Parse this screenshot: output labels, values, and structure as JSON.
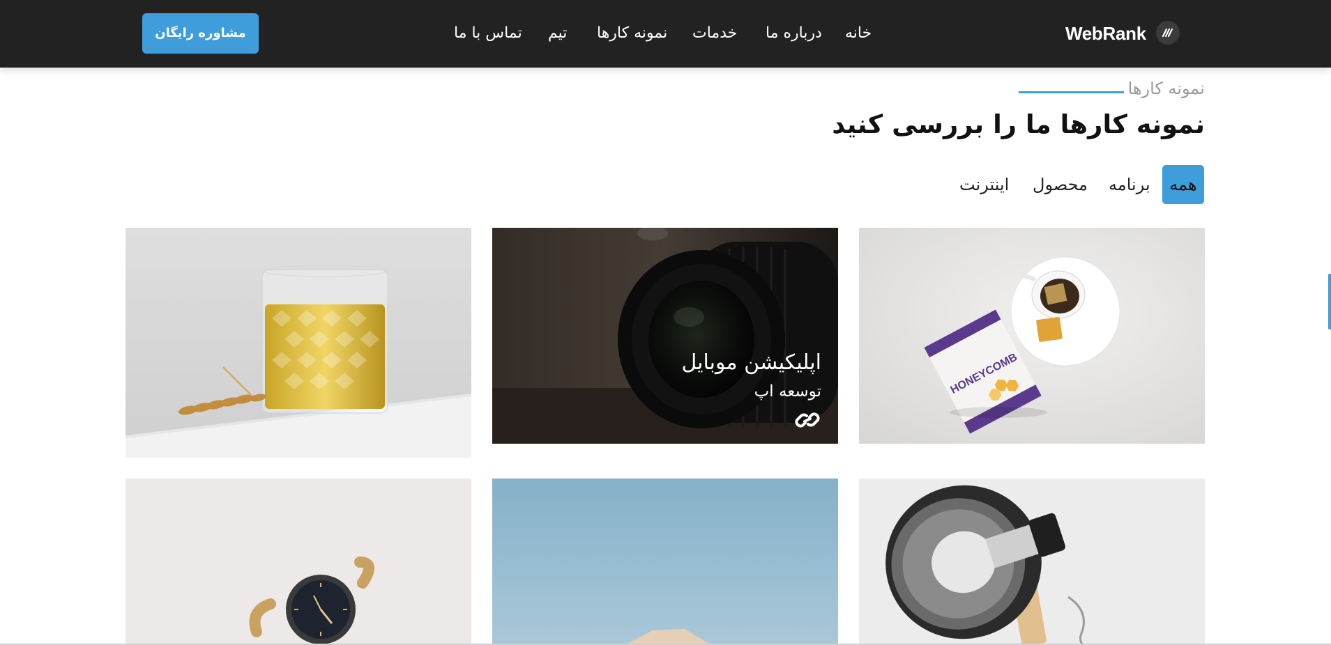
{
  "header": {
    "brand": "WebRank",
    "brand_logo_icon": "webrank-logo-icon",
    "cta_label": "مشاوره رایگان",
    "nav": [
      "خانه",
      "درباره ما",
      "خدمات",
      "نمونه کارها",
      "تیم",
      "تماس با ما"
    ]
  },
  "portfolio": {
    "eyebrow": "نمونه کارها",
    "title": "نمونه کارها ما را بررسی کنید",
    "filters": [
      "همه",
      "برنامه",
      "محصول",
      "اینترنت"
    ],
    "active_filter": "همه",
    "items": [
      {
        "image": "honeycomb-tea-product-photo"
      },
      {
        "image": "camera-lens-photo",
        "title": "اپلیکیشن موبایل",
        "subtitle": "توسعه اپ",
        "link_icon": "link-icon"
      },
      {
        "image": "glass-of-oil-with-wheat-photo"
      },
      {
        "image": "desk-lamp-photo"
      },
      {
        "image": "blue-sky-product-photo"
      },
      {
        "image": "wrist-watch-photo"
      }
    ]
  },
  "colors": {
    "header_bg": "#222222",
    "accent": "#3f9ddb",
    "text": "#111111",
    "muted": "#9a9a9a"
  }
}
